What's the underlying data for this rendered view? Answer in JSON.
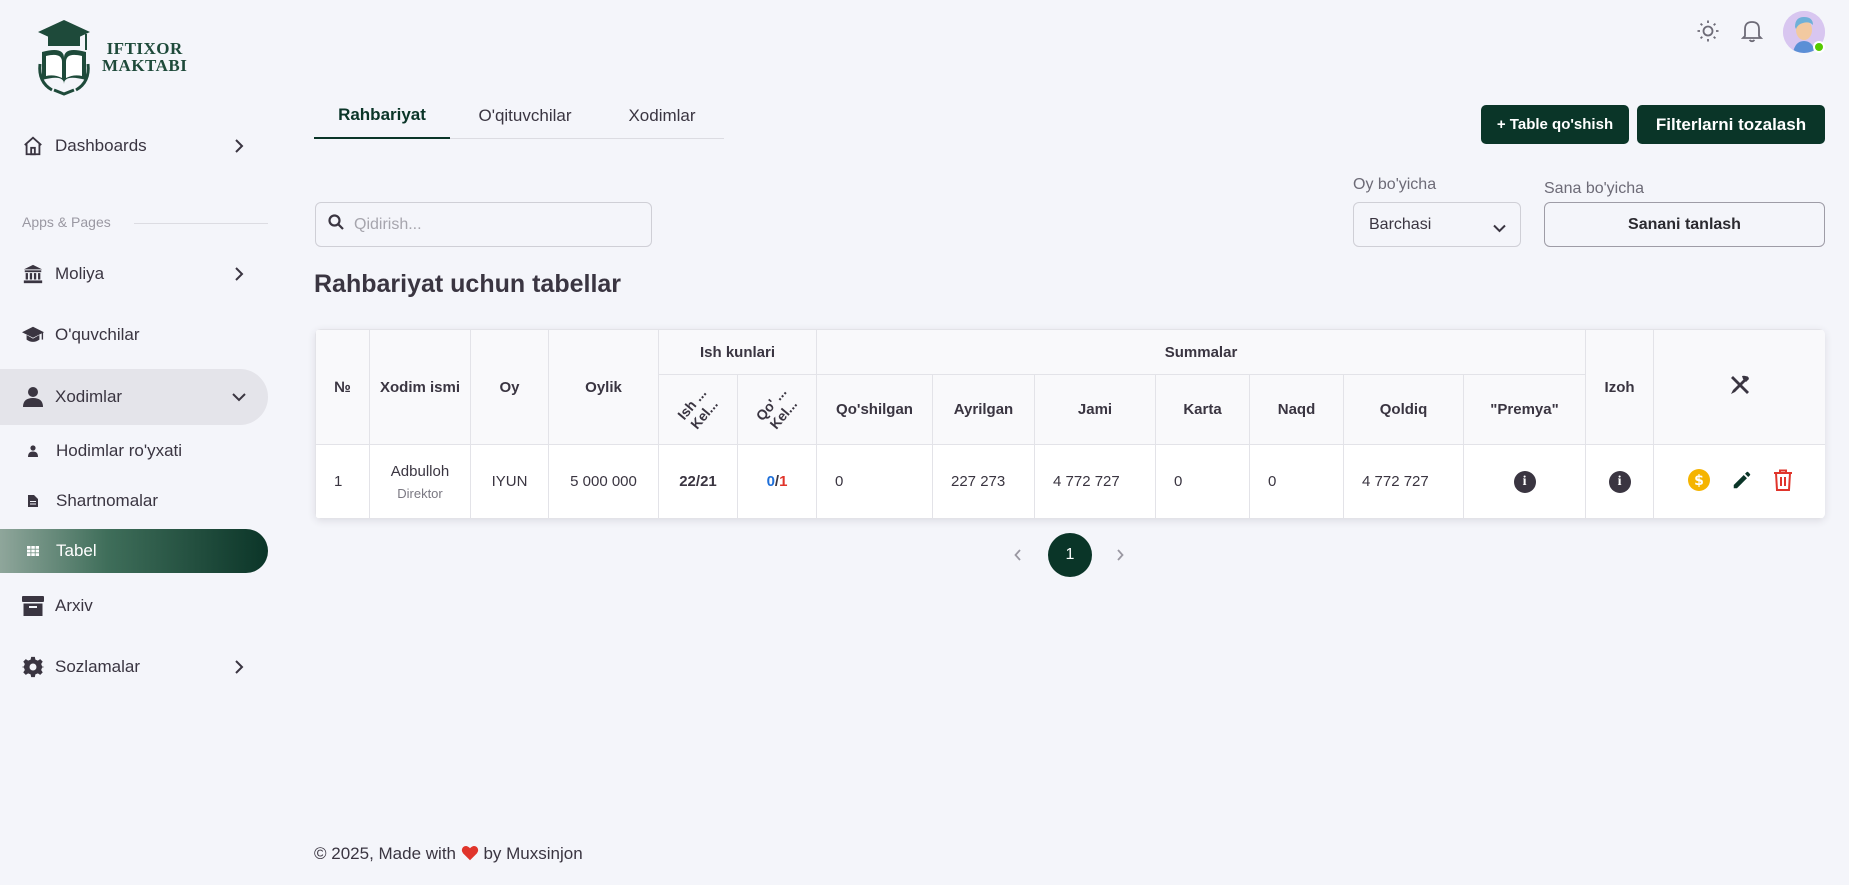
{
  "logo": {
    "line1": "IFTIXOR",
    "line2": "MAKTABI"
  },
  "sidebar": {
    "section_label": "Apps & Pages",
    "items": {
      "dashboards": "Dashboards",
      "moliya": "Moliya",
      "oquvchilar": "O'quvchilar",
      "xodimlar": "Xodimlar",
      "hodimlar_royxati": "Hodimlar ro'yxati",
      "shartnomalar": "Shartnomalar",
      "tabel": "Tabel",
      "arxiv": "Arxiv",
      "sozlamalar": "Sozlamalar"
    }
  },
  "tabs": [
    "Rahbariyat",
    "O'qituvchilar",
    "Xodimlar"
  ],
  "buttons": {
    "add_table": "+ Table qo'shish",
    "clear_filters": "Filterlarni tozalash"
  },
  "search": {
    "placeholder": "Qidirish..."
  },
  "filters": {
    "month_label": "Oy bo'yicha",
    "month_value": "Barchasi",
    "date_label": "Sana bo'yicha",
    "date_button": "Sanani tanlash"
  },
  "page_title": "Rahbariyat uchun tabellar",
  "table": {
    "headers": {
      "no": "№",
      "name": "Xodim ismi",
      "month": "Oy",
      "salary": "Oylik",
      "work_days": "Ish kunlari",
      "wd_sub1_a": "Ish ...",
      "wd_sub1_b": "Kel...",
      "wd_sub2_a": "Qo' ...",
      "wd_sub2_b": "Kel...",
      "sums": "Summalar",
      "added": "Qo'shilgan",
      "deducted": "Ayrilgan",
      "total": "Jami",
      "card": "Karta",
      "cash": "Naqd",
      "rest": "Qoldiq",
      "bonus": "\"Premya\"",
      "note": "Izoh"
    },
    "rows": [
      {
        "no": "1",
        "name": "Adbulloh",
        "role": "Direktor",
        "month": "IYUN",
        "salary": "5 000 000",
        "work_a": "22",
        "work_b": "21",
        "extra_a": "0",
        "extra_b": "1",
        "added": "0",
        "deducted": "227 273",
        "total": "4 772 727",
        "card": "0",
        "cash": "0",
        "rest": "4 772 727"
      }
    ]
  },
  "pagination": {
    "current": "1"
  },
  "footer": {
    "text_before": "© 2025, Made with",
    "text_after": "by Muxsinjon"
  },
  "colors": {
    "accent": "#0a3528",
    "blue": "#1e6fd9",
    "red": "#e0342b",
    "coin": "#f5b400",
    "trash": "#e0342b"
  }
}
